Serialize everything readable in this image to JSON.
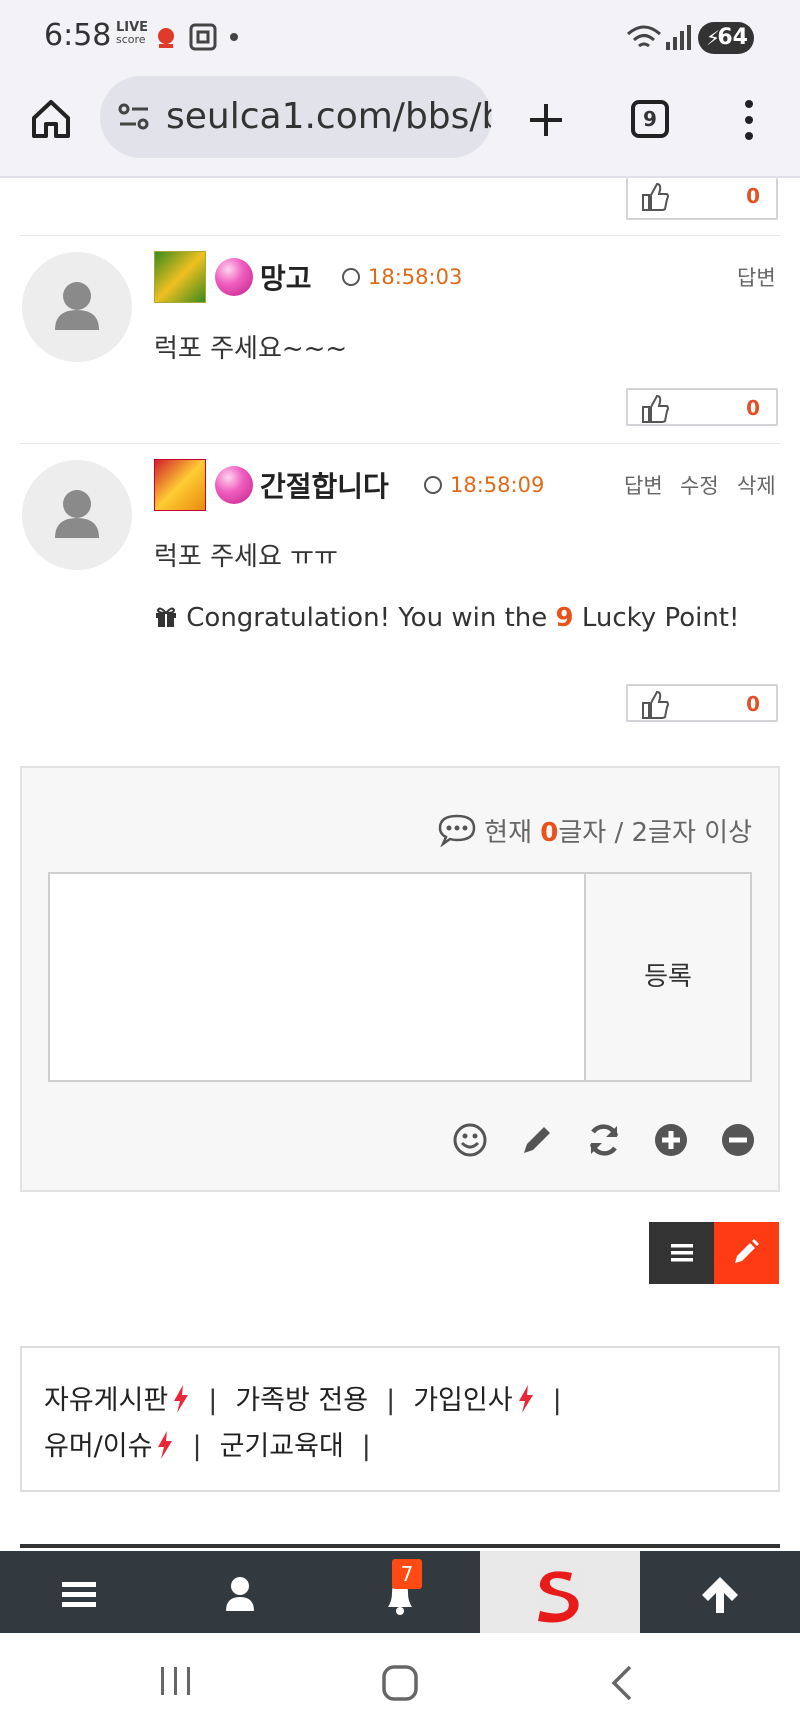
{
  "status_bar": {
    "time": "6:58",
    "live_line1": "LIVE",
    "live_line2": "score",
    "battery": "64"
  },
  "browser": {
    "url": "seulca1.com/bbs/b",
    "tab_count": "9"
  },
  "comments": [
    {
      "nickname": "망고",
      "time": "18:58:03",
      "text": "럭포 주세요~~~",
      "actions": [
        "답변"
      ],
      "likes": "0"
    },
    {
      "nickname": "간절합니다",
      "time": "18:58:09",
      "text": "럭포 주세요 ㅠㅠ",
      "actions": [
        "답변",
        "수정",
        "삭제"
      ],
      "likes": "0",
      "lucky": {
        "prefix": "Congratulation! You win the",
        "points": "9",
        "suffix": "Lucky Point!"
      }
    }
  ],
  "top_like_count": "0",
  "comment_form": {
    "counter_prefix": "현재",
    "counter_value": "0",
    "counter_suffix": "글자 / 2글자 이상",
    "submit_label": "등록"
  },
  "menu": {
    "row1": [
      "자유게시판",
      "가족방 전용",
      "가입인사"
    ],
    "row2": [
      "유머/이슈",
      "군기교육대"
    ]
  },
  "bottom_nav": {
    "notification_count": "7"
  },
  "colors": {
    "accent": "#ff3b14",
    "timestamp": "#e06a1a",
    "nav_bg": "#32393f"
  }
}
